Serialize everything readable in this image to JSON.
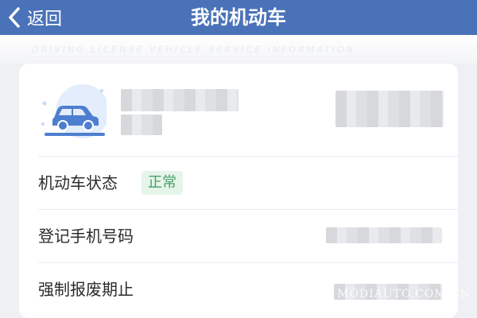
{
  "navbar": {
    "back_label": "返回",
    "title": "我的机动车"
  },
  "banner": {
    "text": "DRIVING LICENSE VEHICLE SERVICE INFORMATION"
  },
  "vehicle": {
    "icon": "car-icon"
  },
  "rows": [
    {
      "label": "机动车状态",
      "badge": "正常"
    },
    {
      "label": "登记手机号码"
    },
    {
      "label": "强制报废期止"
    }
  ],
  "watermark": "MODIAUTO.COM.CN",
  "colors": {
    "navbar": "#4a72b8",
    "badge_text": "#4a9f6a",
    "badge_bg": "#e6f4ea",
    "car_blue": "#4d7fd0"
  }
}
